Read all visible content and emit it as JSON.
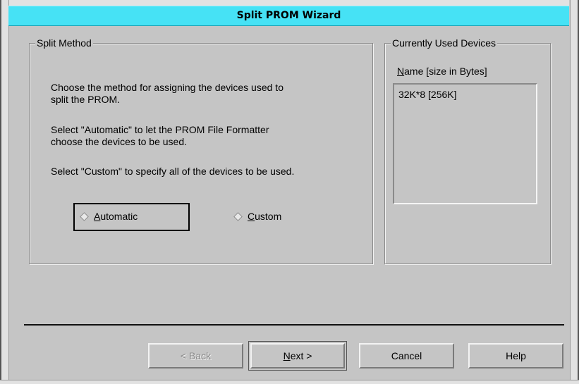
{
  "window": {
    "title": "Split PROM Wizard"
  },
  "split_method": {
    "legend": "Split Method",
    "lines": [
      "Choose the method for assigning the devices used to",
      "split the PROM.",
      "Select \"Automatic\" to let the PROM File Formatter",
      "choose the devices to be used.",
      "Select \"Custom\" to specify all of the devices to be used."
    ],
    "options": [
      {
        "mnemonic": "A",
        "rest": "utomatic",
        "selected": true
      },
      {
        "mnemonic": "C",
        "rest": "ustom",
        "selected": false
      }
    ]
  },
  "devices": {
    "legend": "Currently Used Devices",
    "header_mnemonic": "N",
    "header_rest": "ame [size in Bytes]",
    "items": [
      "32K*8  [256K]"
    ]
  },
  "buttons": {
    "back_mnemonic": "< B",
    "back_rest": "ack",
    "next_mnemonic": "N",
    "next_rest": "ext >",
    "cancel": "Cancel",
    "help": "Help"
  }
}
